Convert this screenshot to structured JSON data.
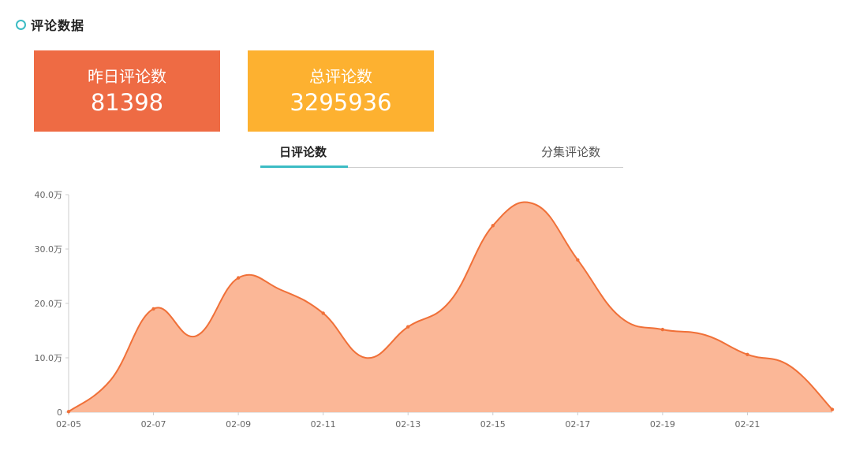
{
  "header": {
    "title": "评论数据"
  },
  "cards": [
    {
      "label": "昨日评论数",
      "value": "81398",
      "color": "#ee6b44"
    },
    {
      "label": "总评论数",
      "value": "3295936",
      "color": "#fdb130"
    }
  ],
  "tabs": [
    {
      "label": "日评论数",
      "active": true
    },
    {
      "label": "分集评论数",
      "active": false
    }
  ],
  "colors": {
    "accent": "#3cbcc4",
    "line": "#f07038",
    "area": "#fbb797"
  },
  "chart_data": {
    "type": "area",
    "x": [
      "02-05",
      "02-06",
      "02-07",
      "02-08",
      "02-09",
      "02-10",
      "02-11",
      "02-12",
      "02-13",
      "02-14",
      "02-15",
      "02-16",
      "02-17",
      "02-18",
      "02-19",
      "02-20",
      "02-21",
      "02-22",
      "02-23"
    ],
    "values": [
      0.1,
      6,
      19,
      14,
      24.7,
      22.5,
      18.2,
      10,
      15.7,
      20.5,
      34.3,
      38.2,
      28,
      17.5,
      15.2,
      14.2,
      10.6,
      8.5,
      0.5
    ],
    "series_unit": "万",
    "ylim": [
      0,
      40
    ],
    "yticks": [
      "0",
      "10.0万",
      "20.0万",
      "30.0万",
      "40.0万"
    ],
    "xticks": [
      "02-05",
      "02-07",
      "02-09",
      "02-11",
      "02-13",
      "02-15",
      "02-17",
      "02-19",
      "02-21"
    ],
    "smooth": true,
    "grid": false
  }
}
